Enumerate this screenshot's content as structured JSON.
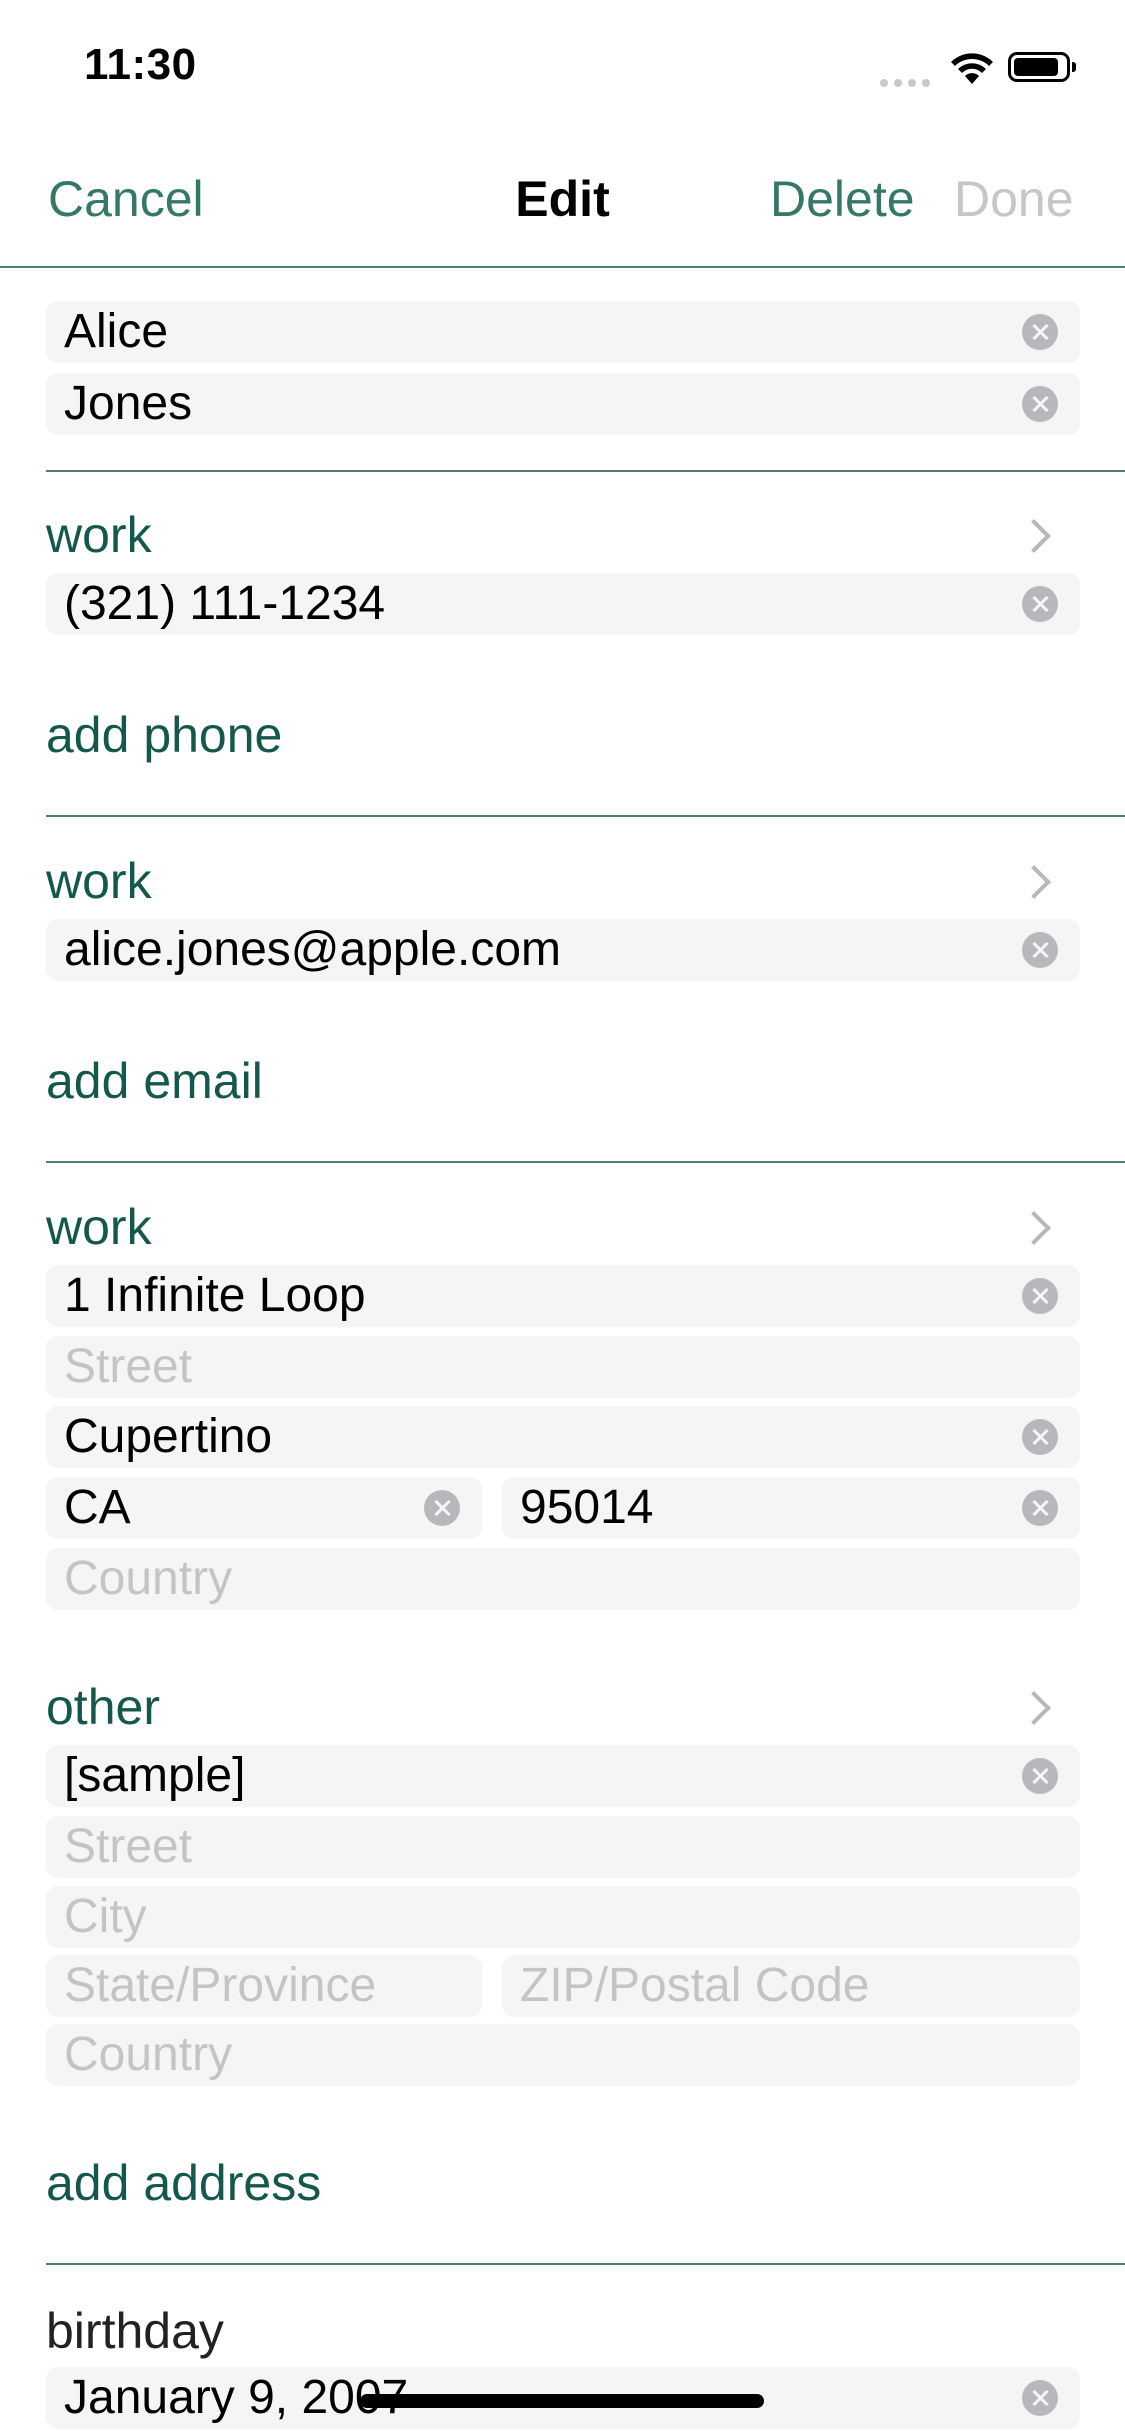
{
  "status_bar": {
    "time": "11:30"
  },
  "nav": {
    "cancel": "Cancel",
    "title": "Edit",
    "delete": "Delete",
    "done": "Done"
  },
  "name": {
    "first": "Alice",
    "last": "Jones"
  },
  "phone": {
    "label": "work",
    "value": "(321) 111-1234",
    "add": "add phone"
  },
  "email": {
    "label": "work",
    "value": "alice.jones@apple.com",
    "add": "add email"
  },
  "address_work": {
    "label": "work",
    "line1": "1 Infinite Loop",
    "street_placeholder": "Street",
    "city": "Cupertino",
    "state": "CA",
    "zip": "95014",
    "country_placeholder": "Country"
  },
  "address_other": {
    "label": "other",
    "line1": "[sample]",
    "street_placeholder": "Street",
    "city_placeholder": "City",
    "state_placeholder": "State/Province",
    "zip_placeholder": "ZIP/Postal Code",
    "country_placeholder": "Country",
    "add": "add address"
  },
  "birthday": {
    "label": "birthday",
    "value": "January 9, 2007"
  },
  "colors": {
    "accent": "#34786a",
    "label": "#14574c",
    "field_bg": "#f5f5f5",
    "placeholder": "#c4c4c6"
  }
}
